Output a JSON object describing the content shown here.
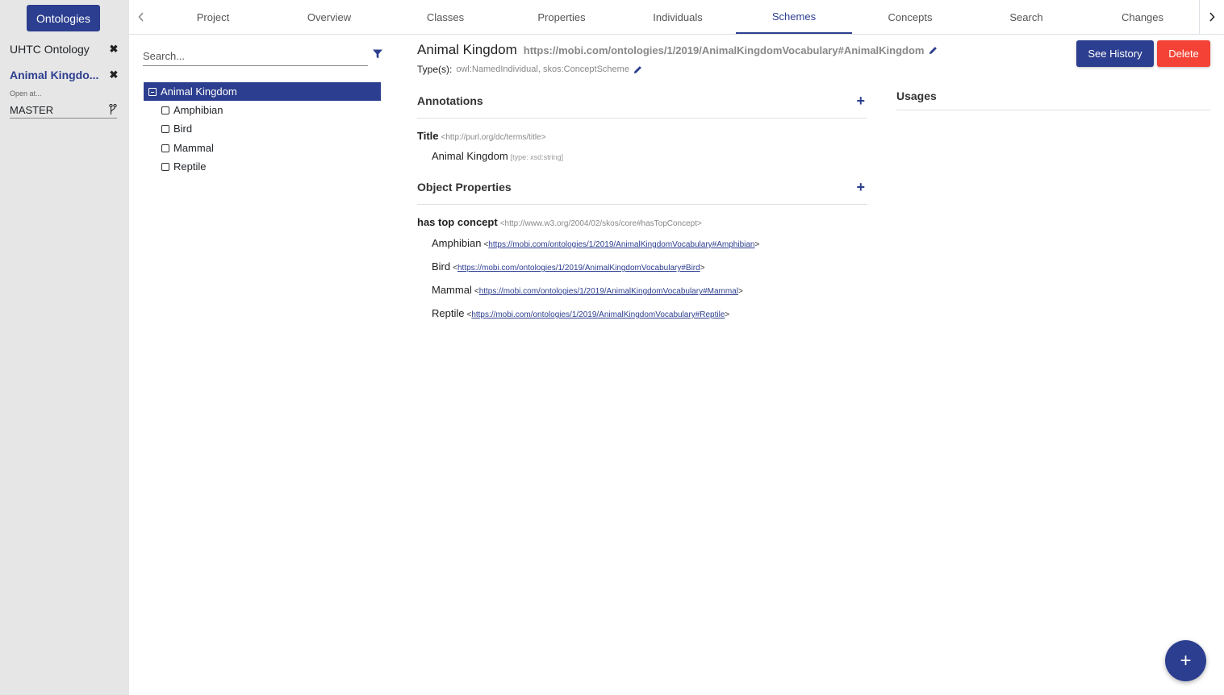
{
  "sidebar": {
    "ontologies_button": "Ontologies",
    "open_items": [
      {
        "label": "UHTC Ontology",
        "close": "✖"
      },
      {
        "label": "Animal Kingdo...",
        "close": "✖"
      }
    ],
    "open_at_label": "Open at...",
    "branch": "MASTER"
  },
  "tabs": [
    "Project",
    "Overview",
    "Classes",
    "Properties",
    "Individuals",
    "Schemes",
    "Concepts",
    "Search",
    "Changes"
  ],
  "active_tab": "Schemes",
  "tree": {
    "search_placeholder": "Search...",
    "root": "Animal Kingdom",
    "children": [
      "Amphibian",
      "Bird",
      "Mammal",
      "Reptile"
    ]
  },
  "entity": {
    "title": "Animal Kingdom",
    "iri": "https://mobi.com/ontologies/1/2019/AnimalKingdomVocabulary#AnimalKingdom",
    "types_label": "Type(s):",
    "types_value": "owl:NamedIndividual, skos:ConceptScheme"
  },
  "buttons": {
    "history": "See History",
    "delete": "Delete"
  },
  "annotations": {
    "heading": "Annotations",
    "title_label": "Title",
    "title_iri": "<http://purl.org/dc/terms/title>",
    "title_value": "Animal Kingdom",
    "title_type": "[type: xsd:string]"
  },
  "object_properties": {
    "heading": "Object Properties",
    "prop_label": "has top concept",
    "prop_iri": "<http://www.w3.org/2004/02/skos/core#hasTopConcept>",
    "values": [
      {
        "name": "Amphibian",
        "iri": "https://mobi.com/ontologies/1/2019/AnimalKingdomVocabulary#Amphibian"
      },
      {
        "name": "Bird",
        "iri": "https://mobi.com/ontologies/1/2019/AnimalKingdomVocabulary#Bird"
      },
      {
        "name": "Mammal",
        "iri": "https://mobi.com/ontologies/1/2019/AnimalKingdomVocabulary#Mammal"
      },
      {
        "name": "Reptile",
        "iri": "https://mobi.com/ontologies/1/2019/AnimalKingdomVocabulary#Reptile"
      }
    ]
  },
  "usages": {
    "heading": "Usages"
  },
  "fab": "+",
  "colors": {
    "primary": "#2c3e8f",
    "danger": "#f44336",
    "sidebar_bg": "#e6e6e6"
  },
  "icons": {
    "close": "close-icon",
    "branch": "branch-icon",
    "filter": "filter-icon",
    "edit": "pencil-icon",
    "add": "plus-icon"
  }
}
